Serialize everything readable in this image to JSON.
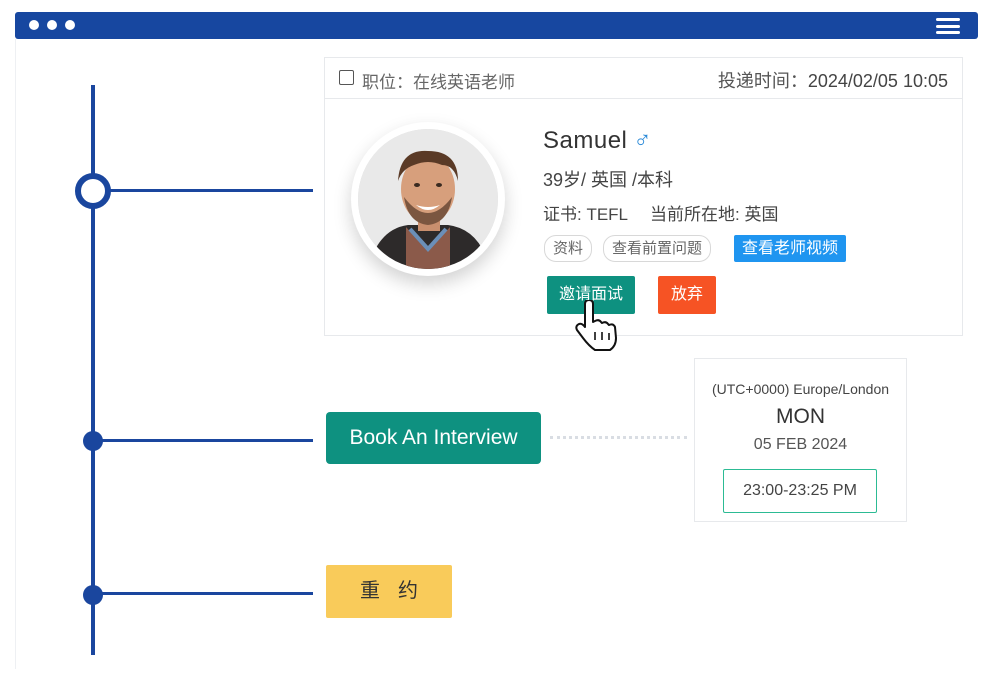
{
  "window": {
    "menu_icon": "hamburger-icon"
  },
  "application": {
    "checkbox_icon": "checkbox-icon",
    "position_label": "职位：在线英语老师",
    "delivery_label": "投递时间：",
    "delivery_time": "2024/02/05 10:05",
    "candidate": {
      "name": "Samuel",
      "gender_symbol": "♂",
      "details": "39岁/ 英国 /本科",
      "cert_label": "证书: TEFL",
      "location_label": "当前所在地: 英国"
    },
    "tags": [
      "资料",
      "查看前置问题"
    ],
    "video_button": "查看老师视频",
    "invite_button": "邀请面试",
    "give_up_button": "放弃"
  },
  "booking": {
    "button": "Book An Interview",
    "timezone": "(UTC+0000) Europe/London",
    "day": "MON",
    "date": "05 FEB 2024",
    "time_slot": "23:00-23:25 PM"
  },
  "reschedule": {
    "button": "重约"
  },
  "colors": {
    "primary_blue": "#1a469e",
    "teal": "#0e9180",
    "orange": "#f65324",
    "sky_blue": "#1f95f0",
    "yellow": "#f9cb5a"
  }
}
